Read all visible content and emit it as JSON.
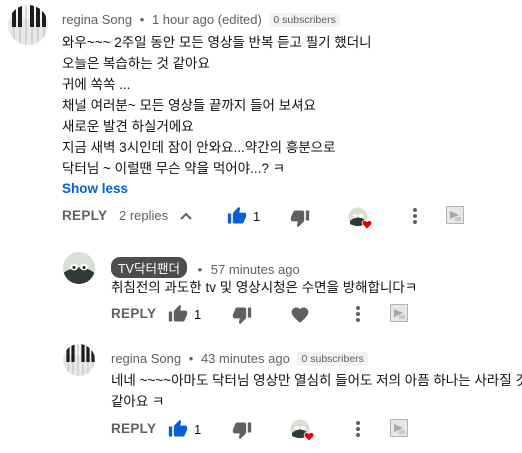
{
  "comment1": {
    "author": "regina Song",
    "dot": "•",
    "time": "1 hour ago (edited)",
    "badge": "0 subscribers",
    "lines": [
      "와우~~~ 2주일 동안  모든 영상들 반복 듣고 필기 했더니",
      "오늘은 복습하는 것 같아요",
      "귀에 쏙쏙 ...",
      "채널 여러분~ 모든 영상들 끝까지 들어 보셔요",
      "새로운 발견 하실거에요",
      "지금 새벽 3시인데 잠이 안와요...약간의 흥분으로",
      "닥터님 ~ 이럴땐 무슨 약을 먹어야...?  ㅋ"
    ],
    "show_less": "Show less",
    "reply_label": "REPLY",
    "replies_label": "2 replies",
    "like_count": "1"
  },
  "reply1": {
    "author": "TV닥터팬더",
    "dot": "•",
    "time": "57 minutes ago",
    "lines": [
      "취침전의 과도한 tv 및 영상시청은 수면을 방해합니다ㅋ"
    ],
    "reply_label": "REPLY",
    "like_count": "1"
  },
  "reply2": {
    "author": "regina Song",
    "dot": "•",
    "time": "43 minutes ago",
    "badge": "0 subscribers",
    "lines": [
      "네네 ~~~~아마도 닥터님 영상만 열심히 들어도 저의 아픔 하나는 사라질 것",
      "같아요 ㅋ"
    ],
    "reply_label": "REPLY",
    "like_count": "1"
  },
  "colors": {
    "like_active": "#065fd4",
    "icon_gray": "#606060",
    "link_blue": "#065fd4",
    "heart_red": "#e00000"
  }
}
